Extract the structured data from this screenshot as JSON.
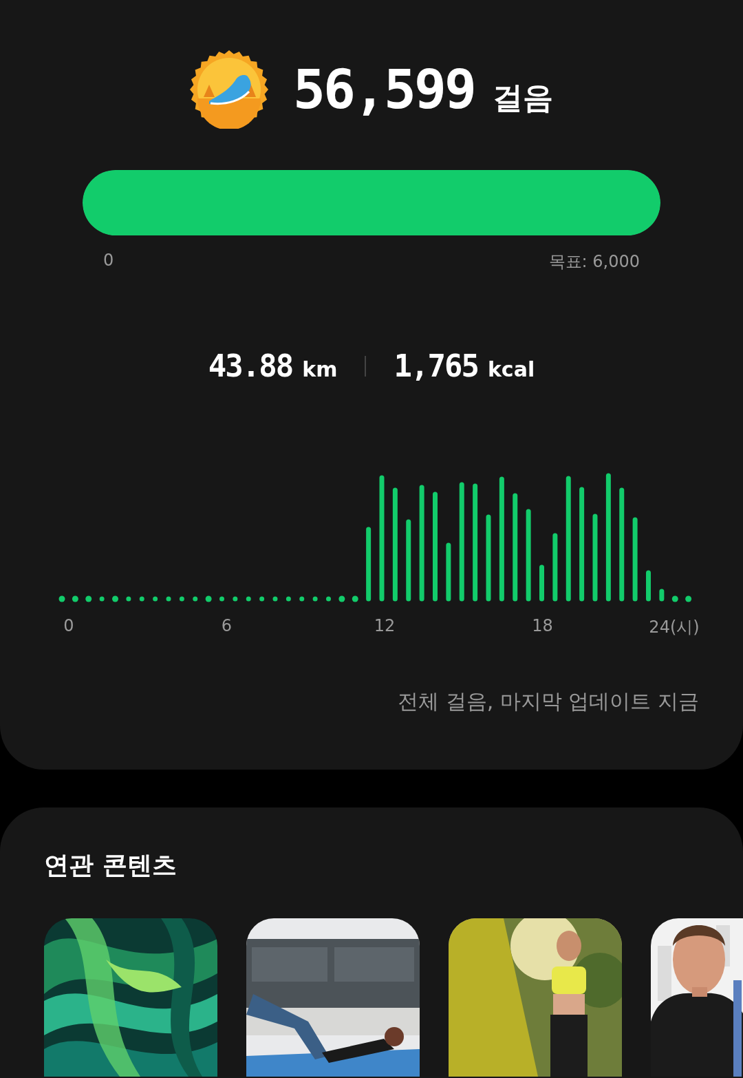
{
  "steps": {
    "value": "56,599",
    "unit": "걸음"
  },
  "progress": {
    "level": 1,
    "start_label": "0",
    "goal_label": "목표: 6,000"
  },
  "stats": [
    {
      "value": "43.88",
      "unit": "km"
    },
    {
      "value": "1,765",
      "unit": "kcal"
    }
  ],
  "activity_chart": {
    "axis_labels": [
      "0",
      "6",
      "12",
      "18",
      "24(시)"
    ]
  },
  "footnote": "전체 걸음, 마지막 업데이트 지금",
  "related": {
    "title": "연관 콘텐츠"
  }
}
